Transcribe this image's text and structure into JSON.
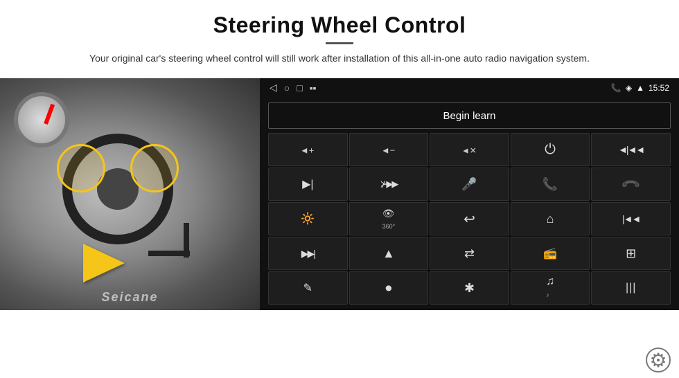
{
  "header": {
    "title": "Steering Wheel Control",
    "subtitle": "Your original car's steering wheel control will still work after installation of this all-in-one auto radio navigation system."
  },
  "screen": {
    "status_bar": {
      "nav_back": "◁",
      "nav_home": "○",
      "nav_recent": "□",
      "signal_icon": "▪▪",
      "phone_icon": "📞",
      "wifi_icon": "◈",
      "signal_bars": "▲",
      "time": "15:52"
    },
    "begin_learn_label": "Begin learn",
    "controls": [
      {
        "icon": "vol_up",
        "sym": "◄+"
      },
      {
        "icon": "vol_down",
        "sym": "◄−"
      },
      {
        "icon": "vol_mute",
        "sym": "◄×"
      },
      {
        "icon": "power",
        "sym": "⏻"
      },
      {
        "icon": "prev_track",
        "sym": "|◄◄"
      },
      {
        "icon": "next_ch",
        "sym": "▶|"
      },
      {
        "icon": "next_track",
        "sym": "⊁▶▶"
      },
      {
        "icon": "mic",
        "sym": "🎤"
      },
      {
        "icon": "phone",
        "sym": "📞"
      },
      {
        "icon": "hang_up",
        "sym": "↩"
      },
      {
        "icon": "brightness",
        "sym": "☼"
      },
      {
        "icon": "360_cam",
        "sym": "👁"
      },
      {
        "icon": "back_nav",
        "sym": "↩"
      },
      {
        "icon": "home_nav",
        "sym": "⌂"
      },
      {
        "icon": "prev_ch",
        "sym": "|◄"
      },
      {
        "icon": "ff_skip",
        "sym": "▶▶|"
      },
      {
        "icon": "nav_arrow",
        "sym": "▲"
      },
      {
        "icon": "eq",
        "sym": "⇄"
      },
      {
        "icon": "radio",
        "sym": "📻"
      },
      {
        "icon": "sliders",
        "sym": "⚙"
      },
      {
        "icon": "pen",
        "sym": "✎"
      },
      {
        "icon": "circle_btn",
        "sym": "⏺"
      },
      {
        "icon": "bluetooth",
        "sym": "✦"
      },
      {
        "icon": "music_note",
        "sym": "♫"
      },
      {
        "icon": "equalizer",
        "sym": "📊"
      }
    ],
    "settings_gear": "⚙"
  },
  "watermark": "Seicane"
}
